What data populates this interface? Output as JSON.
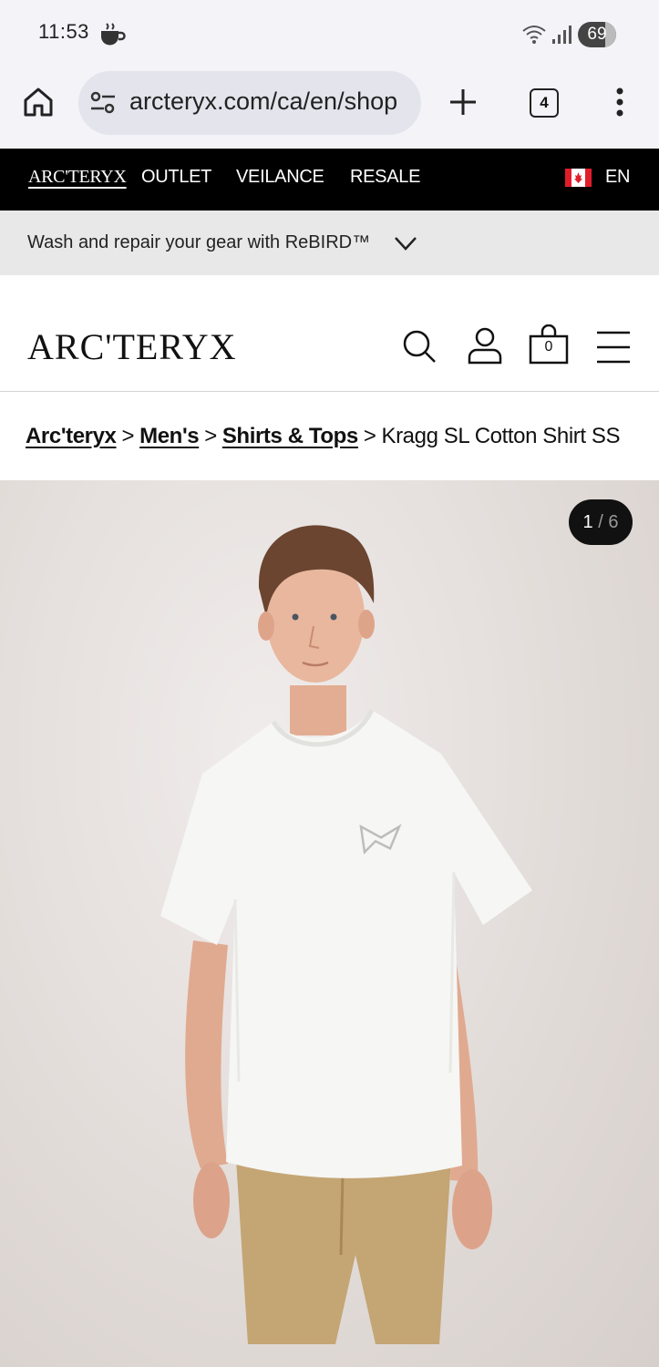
{
  "status_bar": {
    "time": "11:53",
    "battery": "69"
  },
  "browser": {
    "url": "arcteryx.com/ca/en/shop",
    "tab_count": "4"
  },
  "top_nav": {
    "items": [
      "ARC'TERYX",
      "OUTLET",
      "VEILANCE",
      "RESALE"
    ],
    "language": "EN"
  },
  "promo": {
    "text": "Wash and repair your gear with ReBIRD™"
  },
  "header": {
    "logo": "ARC'TERYX",
    "cart_count": "0"
  },
  "breadcrumb": {
    "items": [
      "Arc'teryx",
      "Men's",
      "Shirts & Tops"
    ],
    "current": "Kragg SL Cotton Shirt SS"
  },
  "gallery": {
    "current": "1",
    "separator": "/",
    "total": "6"
  },
  "colors": {
    "nav_bg": "#000000",
    "promo_bg": "#e8e8e8",
    "shirt": "#f6f6f4",
    "shorts": "#c4a574"
  }
}
